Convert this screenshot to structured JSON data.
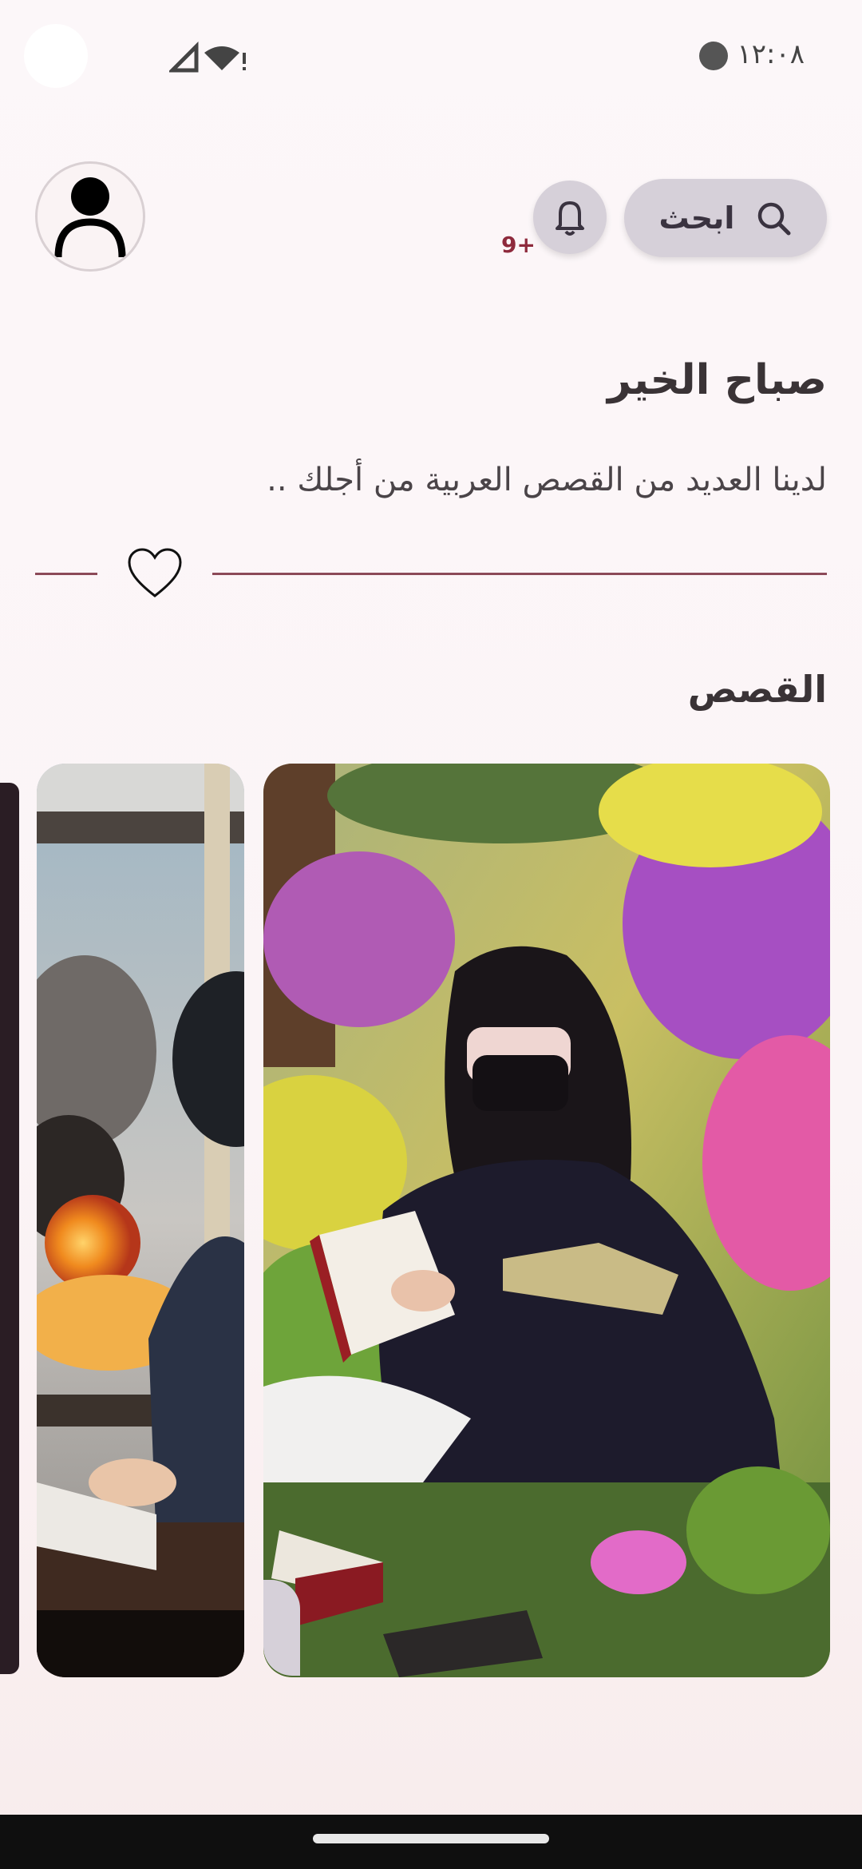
{
  "status_bar": {
    "time": "١٢:٠٨",
    "icons": [
      "wifi-icon",
      "signal-icon",
      "face-icon"
    ]
  },
  "header": {
    "search_label": "ابحث",
    "notification_badge": "9+",
    "icons": [
      "search-icon",
      "bell-icon",
      "user-avatar-icon"
    ]
  },
  "greeting": {
    "title": "صباح الخير",
    "subtitle": "لدينا العديد من القصص العربية من أجلك .."
  },
  "stories": {
    "section_title": "القصص",
    "cards": [
      {
        "scene": "girl-reading-in-garden"
      },
      {
        "scene": "boy-at-window-explosion"
      }
    ]
  },
  "colors": {
    "accent": "#8c4a58",
    "button_bg": "#d6d0d9",
    "text": "#3a3336"
  }
}
